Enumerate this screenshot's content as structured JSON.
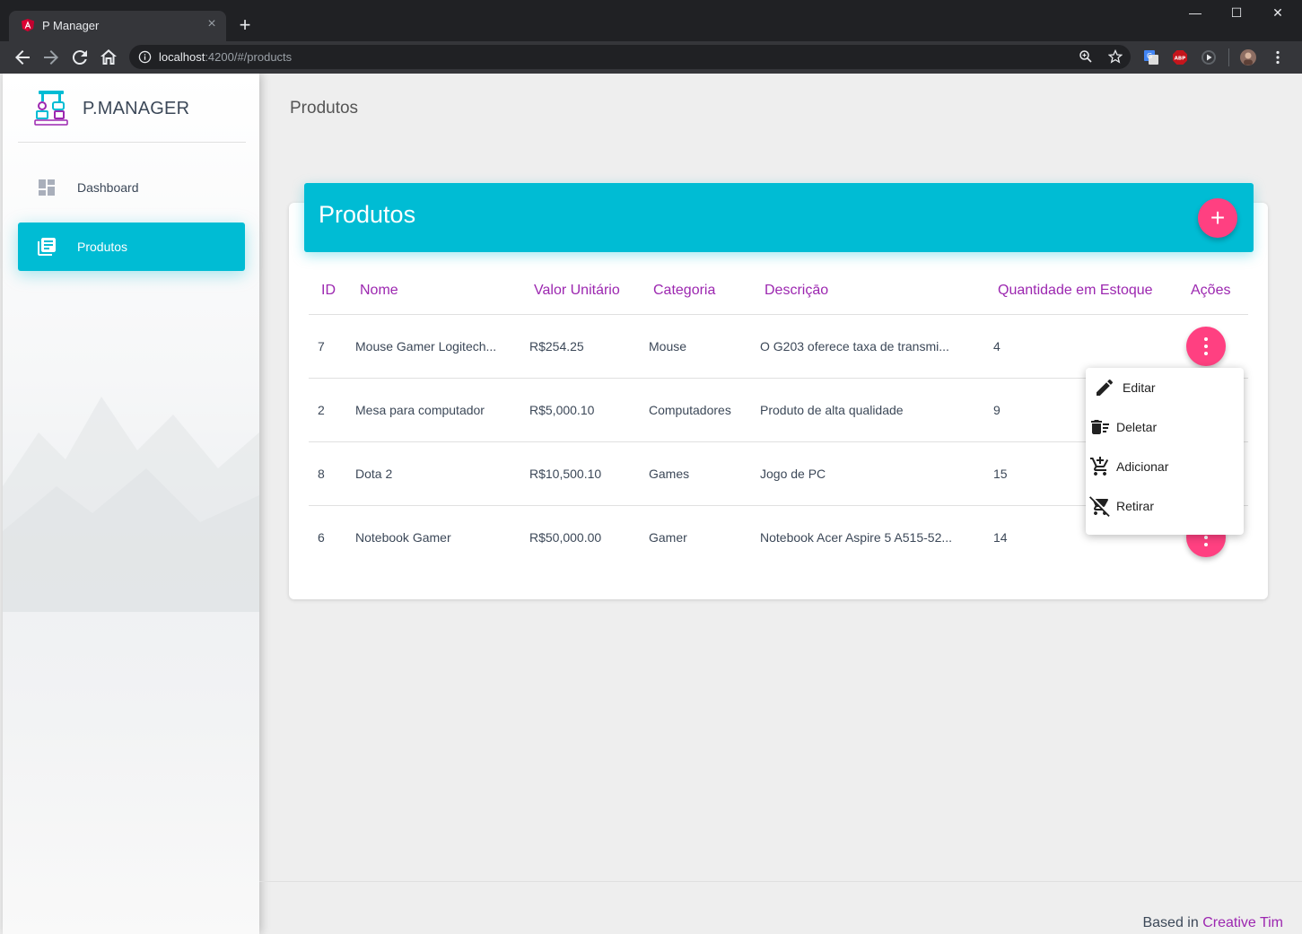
{
  "browser": {
    "tab_title": "P Manager",
    "url_host": "localhost",
    "url_rest": ":4200/#/products",
    "window_controls": [
      "minimize",
      "maximize",
      "close"
    ]
  },
  "sidebar": {
    "brand": "P.MANAGER",
    "items": [
      {
        "label": "Dashboard",
        "icon": "dashboard-icon",
        "active": false
      },
      {
        "label": "Produtos",
        "icon": "library-books-icon",
        "active": true
      }
    ]
  },
  "page": {
    "title": "Produtos"
  },
  "card": {
    "title": "Produtos",
    "add_icon": "plus-icon",
    "columns": [
      "ID",
      "Nome",
      "Valor Unitário",
      "Categoria",
      "Descriçāo",
      "Quantidade em Estoque",
      "Ações"
    ],
    "rows": [
      {
        "id": "7",
        "nome": "Mouse Gamer Logitech...",
        "valor": "R$254.25",
        "categoria": "Mouse",
        "descricao": "O G203 oferece taxa de transmi...",
        "quantidade": "4"
      },
      {
        "id": "2",
        "nome": "Mesa para computador",
        "valor": "R$5,000.10",
        "categoria": "Computadores",
        "descricao": "Produto de alta qualidade",
        "quantidade": "9"
      },
      {
        "id": "8",
        "nome": "Dota 2",
        "valor": "R$10,500.10",
        "categoria": "Games",
        "descricao": "Jogo de PC",
        "quantidade": "15"
      },
      {
        "id": "6",
        "nome": "Notebook Gamer",
        "valor": "R$50,000.00",
        "categoria": "Gamer",
        "descricao": "Notebook Acer Aspire 5 A515-52...",
        "quantidade": "14"
      }
    ]
  },
  "actions_menu": {
    "items": [
      {
        "label": "Editar",
        "icon": "pencil-icon"
      },
      {
        "label": "Deletar",
        "icon": "delete-sweep-icon"
      },
      {
        "label": "Adicionar",
        "icon": "cart-add-icon"
      },
      {
        "label": "Retirar",
        "icon": "cart-remove-icon"
      }
    ]
  },
  "footer": {
    "prefix": "Based in ",
    "link": "Creative Tim"
  },
  "colors": {
    "accent": "#00bcd4",
    "fab": "#ff4081",
    "header_text": "#9c27b0"
  }
}
